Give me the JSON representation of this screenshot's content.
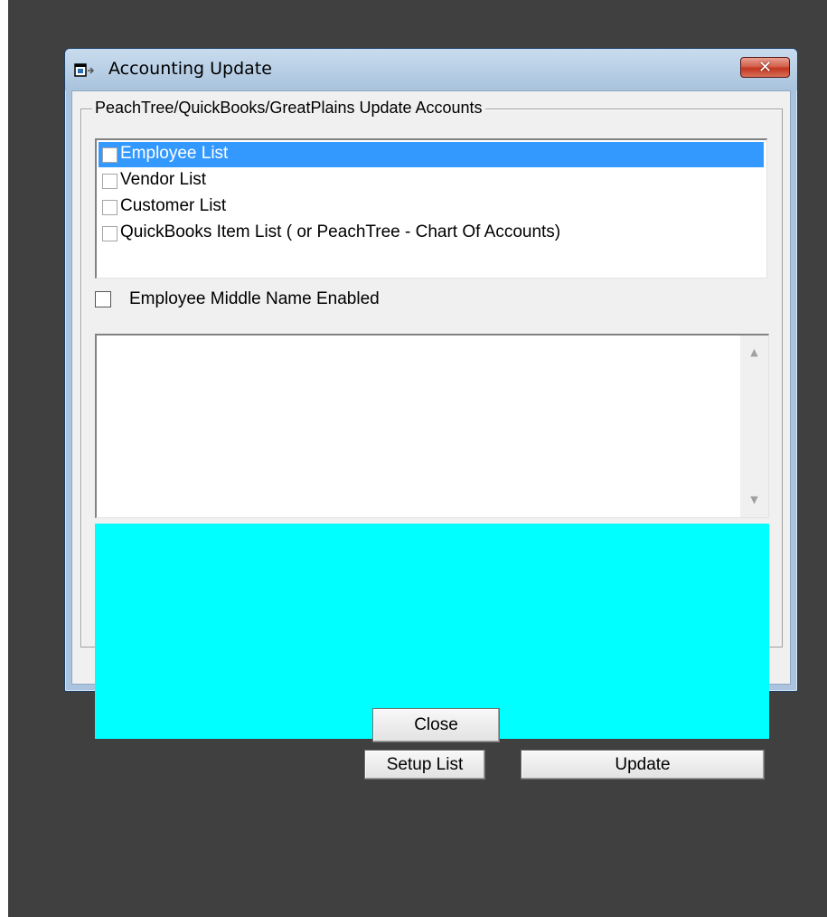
{
  "window": {
    "title": "Accounting Update",
    "close_glyph": "✕",
    "icon": "app-window-icon"
  },
  "group": {
    "caption": "PeachTree/QuickBooks/GreatPlains Update Accounts",
    "items": [
      {
        "label": "Employee List",
        "checked": false,
        "selected": true
      },
      {
        "label": "Vendor List",
        "checked": false,
        "selected": false
      },
      {
        "label": "Customer List",
        "checked": false,
        "selected": false
      },
      {
        "label": "QuickBooks Item List ( or PeachTree - Chart Of Accounts)",
        "checked": false,
        "selected": false
      }
    ],
    "middle_name_checkbox": {
      "label": "Employee Middle Name Enabled",
      "checked": false
    },
    "log_text": "",
    "status_panel_color": "#00ffff",
    "setup_button": "Setup List",
    "update_button": "Update"
  },
  "footer": {
    "close_button": "Close"
  },
  "colors": {
    "desktop": "#404040",
    "selection": "#3399ff",
    "dialog_face": "#f0f0f0"
  }
}
